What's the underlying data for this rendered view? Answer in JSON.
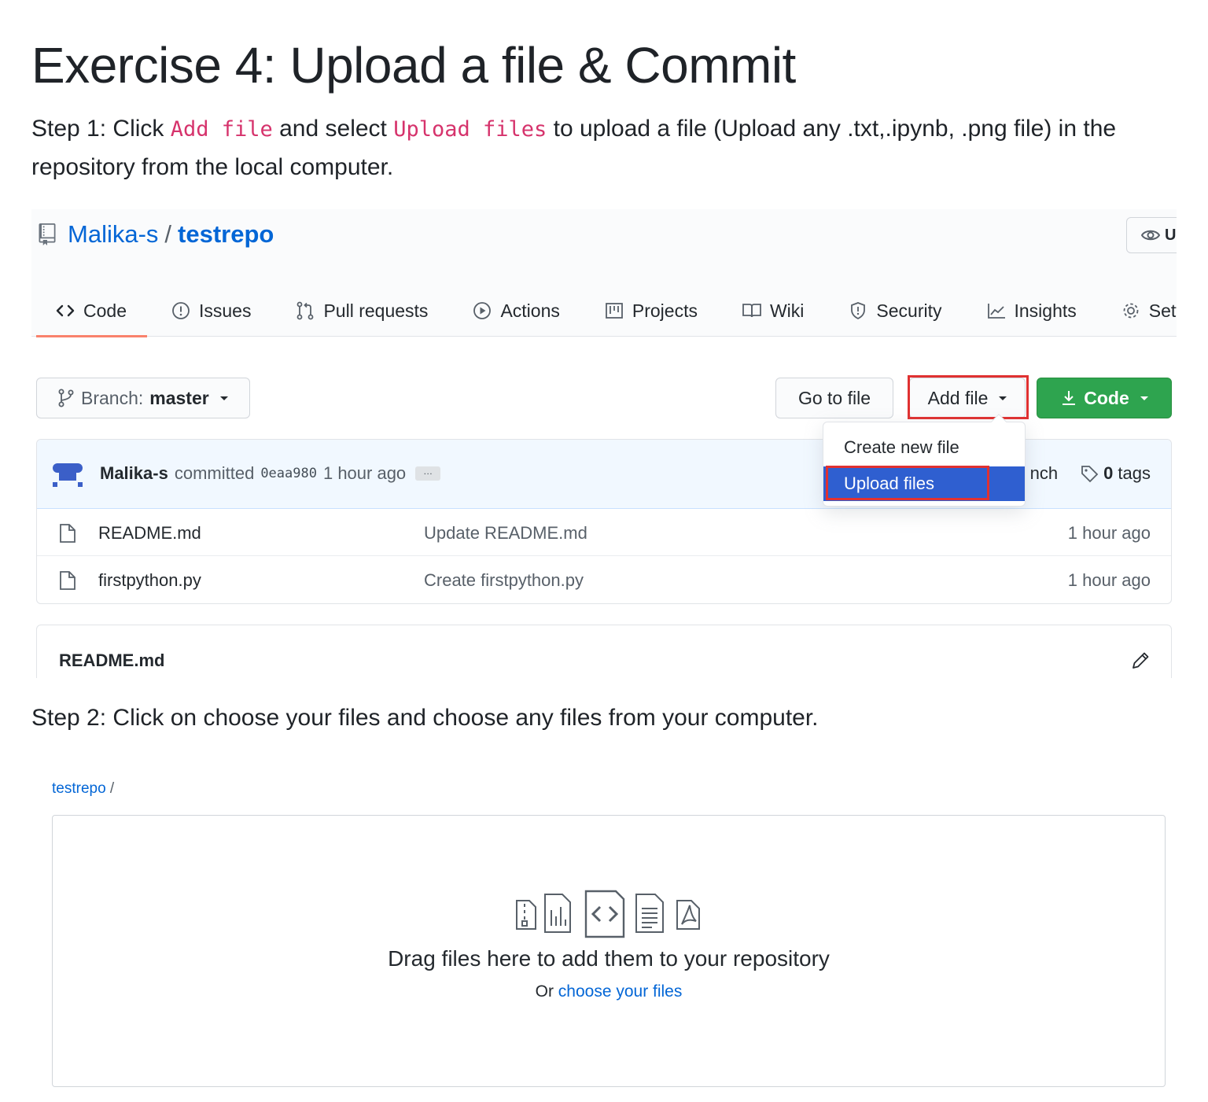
{
  "doc": {
    "title": "Exercise 4: Upload a file & Commit",
    "step1": {
      "prefix": "Step 1: Click ",
      "code1": "Add file",
      "middle": " and select ",
      "code2": "Upload files",
      "suffix": " to upload a file (Upload any .txt,.ipynb, .png file) in the repository from the local computer."
    },
    "step2": "Step 2: Click on choose your files and choose any files from your computer."
  },
  "repo_view": {
    "owner": "Malika-s",
    "separator": "/",
    "repo": "testrepo",
    "watch_label": "U",
    "tabs": [
      {
        "label": "Code",
        "icon": "code-icon",
        "selected": true
      },
      {
        "label": "Issues",
        "icon": "issue-icon"
      },
      {
        "label": "Pull requests",
        "icon": "pull-request-icon"
      },
      {
        "label": "Actions",
        "icon": "play-icon"
      },
      {
        "label": "Projects",
        "icon": "project-icon"
      },
      {
        "label": "Wiki",
        "icon": "book-icon"
      },
      {
        "label": "Security",
        "icon": "shield-icon"
      },
      {
        "label": "Insights",
        "icon": "graph-icon"
      },
      {
        "label": "Settings",
        "icon": "gear-icon"
      }
    ],
    "branch": {
      "label": "Branch:",
      "value": "master"
    },
    "go_to_file": "Go to file",
    "add_file": "Add file",
    "code_button": "Code",
    "dropdown": {
      "create": "Create new file",
      "upload": "Upload files"
    },
    "commit": {
      "author": "Malika-s",
      "verb": "committed",
      "sha": "0eaa980",
      "time": "1 hour ago",
      "ellipsis": "…",
      "branch_partial": "nch",
      "tags_count": "0",
      "tags_label": "tags"
    },
    "files": [
      {
        "name": "README.md",
        "message": "Update README.md",
        "age": "1 hour ago"
      },
      {
        "name": "firstpython.py",
        "message": "Create firstpython.py",
        "age": "1 hour ago"
      }
    ],
    "readme_title": "README.md"
  },
  "upload_view": {
    "crumb_repo": "testrepo",
    "crumb_slash": " /",
    "drop_title": "Drag files here to add them to your repository",
    "drop_or": "Or ",
    "drop_link": "choose your files"
  },
  "colors": {
    "link": "#0366d6",
    "inline_code": "#d6336c",
    "code_button": "#2ea44f",
    "highlight": "#e03131",
    "tab_underline": "#f9826c",
    "dropdown_selected": "#2f5fd0"
  }
}
